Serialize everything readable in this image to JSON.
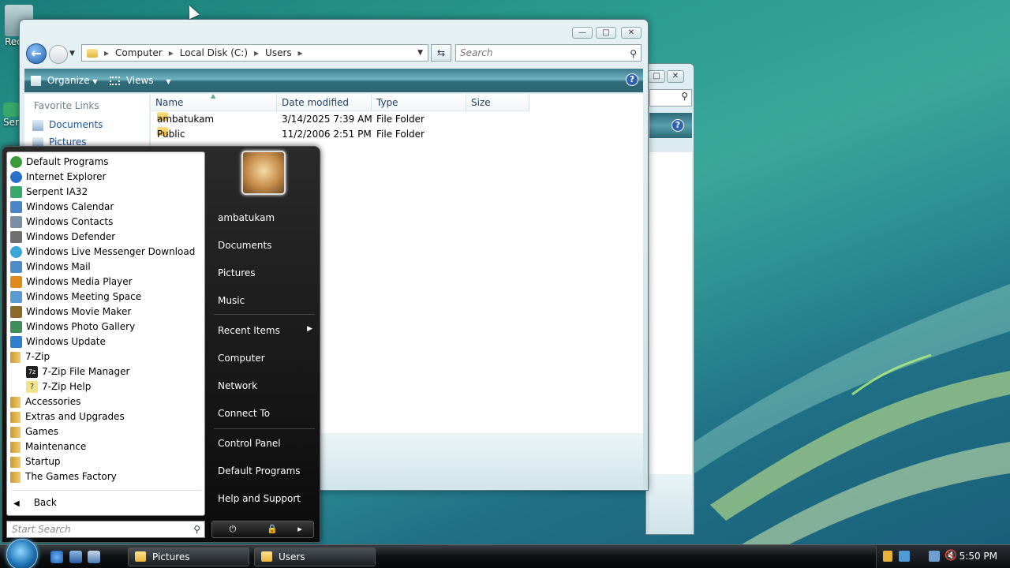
{
  "desktop": {
    "icons": [
      {
        "label": "Rec",
        "icon": "recycle-bin-icon"
      },
      {
        "label": "Ser",
        "icon": "serpent-icon"
      }
    ]
  },
  "explorer": {
    "title_controls": {
      "minimize": "—",
      "maximize": "□",
      "close": "✕"
    },
    "address": {
      "parts": [
        "Computer",
        "Local Disk (C:)",
        "Users"
      ]
    },
    "search_placeholder": "Search",
    "toolbar": {
      "organize": "Organize",
      "views": "Views",
      "help": "?"
    },
    "nav": {
      "header": "Favorite Links",
      "links": [
        "Documents",
        "Pictures"
      ]
    },
    "columns": [
      "Name",
      "Date modified",
      "Type",
      "Size"
    ],
    "rows": [
      {
        "name": "ambatukam",
        "date": "3/14/2025 7:39 AM",
        "type": "File Folder",
        "size": ""
      },
      {
        "name": "Public",
        "date": "11/2/2006 2:51 PM",
        "type": "File Folder",
        "size": ""
      }
    ]
  },
  "start_menu": {
    "programs": [
      {
        "label": "Default Programs",
        "icon": "default-programs-icon",
        "color": "#3a9b3a"
      },
      {
        "label": "Internet Explorer",
        "icon": "internet-explorer-icon",
        "color": "#2a6fc9"
      },
      {
        "label": "Serpent IA32",
        "icon": "serpent-icon",
        "color": "#3aa86a"
      },
      {
        "label": "Windows Calendar",
        "icon": "calendar-icon",
        "color": "#4a86c7"
      },
      {
        "label": "Windows Contacts",
        "icon": "contacts-icon",
        "color": "#7a8fa6"
      },
      {
        "label": "Windows Defender",
        "icon": "defender-icon",
        "color": "#6f6f6f"
      },
      {
        "label": "Windows Live Messenger Download",
        "icon": "messenger-icon",
        "color": "#3aa6d8"
      },
      {
        "label": "Windows Mail",
        "icon": "mail-icon",
        "color": "#4e8cc8"
      },
      {
        "label": "Windows Media Player",
        "icon": "media-player-icon",
        "color": "#e08a1c"
      },
      {
        "label": "Windows Meeting Space",
        "icon": "meeting-space-icon",
        "color": "#5a9bd4"
      },
      {
        "label": "Windows Movie Maker",
        "icon": "movie-maker-icon",
        "color": "#8a6a2a"
      },
      {
        "label": "Windows Photo Gallery",
        "icon": "photo-gallery-icon",
        "color": "#3f8f5a"
      },
      {
        "label": "Windows Update",
        "icon": "windows-update-icon",
        "color": "#2f7fd0"
      }
    ],
    "folders": [
      {
        "label": "7-Zip",
        "children": [
          {
            "label": "7-Zip File Manager",
            "icon": "7zip-icon"
          },
          {
            "label": "7-Zip Help",
            "icon": "help-file-icon"
          }
        ]
      },
      {
        "label": "Accessories"
      },
      {
        "label": "Extras and Upgrades"
      },
      {
        "label": "Games"
      },
      {
        "label": "Maintenance"
      },
      {
        "label": "Startup"
      },
      {
        "label": "The Games Factory"
      }
    ],
    "back_label": "Back",
    "search_placeholder": "Start Search",
    "right": {
      "user": "ambatukam",
      "items1": [
        "Documents",
        "Pictures",
        "Music"
      ],
      "recent": "Recent Items",
      "items2": [
        "Computer",
        "Network",
        "Connect To"
      ],
      "items3": [
        "Control Panel",
        "Default Programs",
        "Help and Support"
      ]
    }
  },
  "taskbar": {
    "buttons": [
      "Pictures",
      "Users"
    ],
    "clock": "5:50 PM"
  }
}
